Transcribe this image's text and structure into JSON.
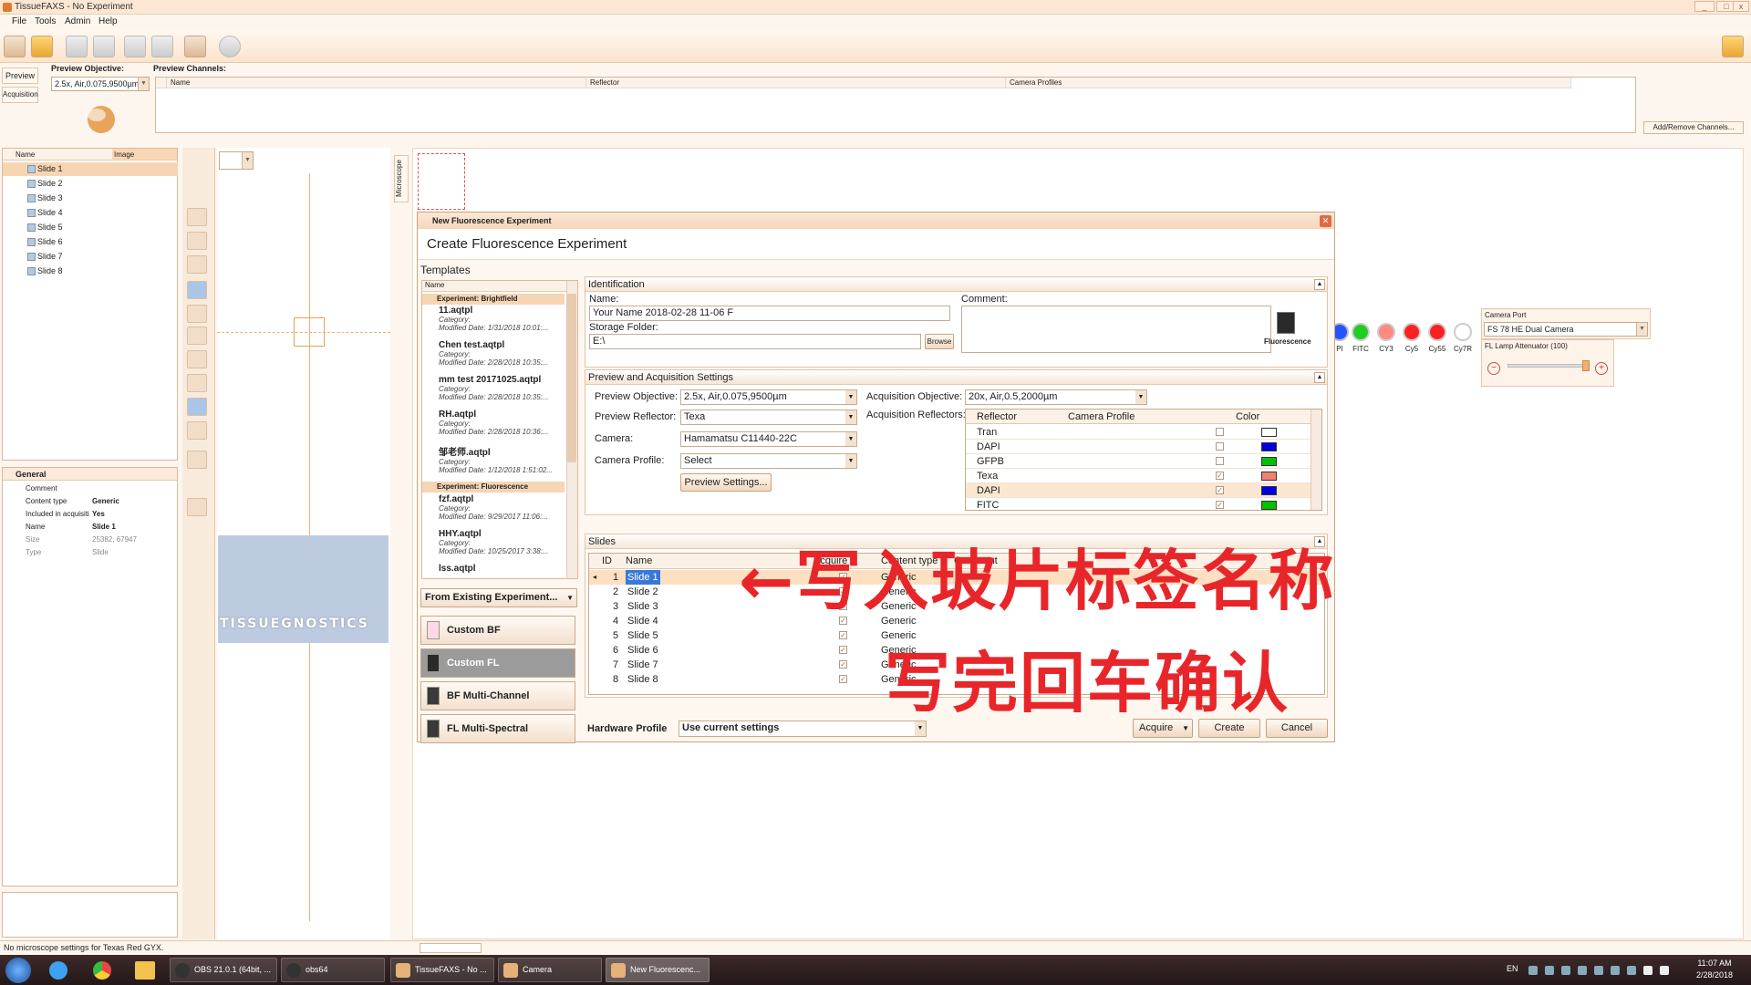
{
  "window": {
    "title": "TissueFAXS - No Experiment"
  },
  "menu": [
    "File",
    "Tools",
    "Admin",
    "Help"
  ],
  "left_tabs": [
    "Preview",
    "Acquisition"
  ],
  "preview_objective": {
    "label": "Preview Objective:",
    "value": "2.5x, Air,0.075,9500µm"
  },
  "preview_channels": {
    "label": "Preview Channels:",
    "columns": [
      "Name",
      "Reflector",
      "Camera Profiles"
    ],
    "add_remove": "Add/Remove Channels..."
  },
  "slide_tree": {
    "columns": [
      "Name",
      "Image"
    ],
    "items": [
      "Slide 1",
      "Slide 2",
      "Slide 3",
      "Slide 4",
      "Slide 5",
      "Slide 6",
      "Slide 7",
      "Slide 8"
    ]
  },
  "general": {
    "title": "General",
    "props": [
      {
        "k": "Comment",
        "v": ""
      },
      {
        "k": "Content type",
        "v": "Generic"
      },
      {
        "k": "Included in acquisiti",
        "v": "Yes"
      },
      {
        "k": "Name",
        "v": "Slide 1"
      },
      {
        "k": "Size",
        "v": "25382, 67947"
      },
      {
        "k": "Type",
        "v": "Slide"
      }
    ]
  },
  "logo": "TISSUEGNOSTICS",
  "microscope_tab": "Microscope",
  "dialog": {
    "title": "New Fluorescence Experiment",
    "subtitle": "Create Fluorescence Experiment",
    "templates": {
      "title": "Templates",
      "col": "Name",
      "groups": [
        {
          "name": "Experiment: Brightfield",
          "items": [
            {
              "n": "11.aqtpl",
              "c": "Category:",
              "d": "Modified Date: 1/31/2018 10:01:..."
            },
            {
              "n": "Chen test.aqtpl",
              "c": "Category:",
              "d": "Modified Date: 2/28/2018 10:35:..."
            },
            {
              "n": "mm test 20171025.aqtpl",
              "c": "Category:",
              "d": "Modified Date: 2/28/2018 10:35:..."
            },
            {
              "n": "RH.aqtpl",
              "c": "Category:",
              "d": "Modified Date: 2/28/2018 10:36:..."
            },
            {
              "n": "邹老师.aqtpl",
              "c": "Category:",
              "d": "Modified Date: 1/12/2018 1:51:02..."
            }
          ]
        },
        {
          "name": "Experiment: Fluorescence",
          "items": [
            {
              "n": "fzf.aqtpl",
              "c": "Category:",
              "d": "Modified Date: 9/29/2017 11:06:..."
            },
            {
              "n": "HHY.aqtpl",
              "c": "Category:",
              "d": "Modified Date: 10/25/2017 3:38:..."
            },
            {
              "n": "lss.aqtpl",
              "c": "",
              "d": ""
            }
          ]
        }
      ],
      "from_existing": "From Existing Experiment...",
      "buttons": [
        "Custom BF",
        "Custom FL",
        "BF Multi-Channel",
        "FL Multi-Spectral"
      ]
    },
    "identification": {
      "title": "Identification",
      "name_label": "Name:",
      "name_value": "Your Name 2018-02-28 11-06 F",
      "storage_label": "Storage Folder:",
      "storage_value": "E:\\",
      "browse": "Browse",
      "comment_label": "Comment:",
      "icon_label": "Fluorescence"
    },
    "settings": {
      "title": "Preview and Acquisition Settings",
      "preview_objective_label": "Preview Objective:",
      "preview_objective": "2.5x, Air,0.075,9500µm",
      "preview_reflector_label": "Preview Reflector:",
      "preview_reflector": "Texa",
      "camera_label": "Camera:",
      "camera": "Hamamatsu C11440-22C",
      "camera_profile_label": "Camera Profile:",
      "camera_profile": "Select",
      "preview_settings": "Preview Settings...",
      "acq_objective_label": "Acquisition Objective:",
      "acq_objective": "20x, Air,0.5,2000µm",
      "acq_reflectors_label": "Acquisition Reflectors:",
      "ref_columns": [
        "Reflector",
        "Camera Profile",
        "Color"
      ],
      "reflectors": [
        {
          "name": "Tran",
          "checked": false,
          "color": "#ffffff"
        },
        {
          "name": "DAPI",
          "checked": false,
          "color": "#0000e0"
        },
        {
          "name": "GFPB",
          "checked": false,
          "color": "#00c000"
        },
        {
          "name": "Texa",
          "checked": true,
          "color": "#f08070"
        },
        {
          "name": "DAPI",
          "checked": true,
          "color": "#0000e0"
        },
        {
          "name": "FITC",
          "checked": true,
          "color": "#00c000"
        }
      ]
    },
    "slides": {
      "title": "Slides",
      "columns": [
        "ID",
        "Name",
        "Acquire",
        "Content type",
        "Comment"
      ],
      "rows": [
        {
          "id": "1",
          "name": "Slide 1",
          "type": "Generic"
        },
        {
          "id": "2",
          "name": "Slide 2",
          "type": "Generic"
        },
        {
          "id": "3",
          "name": "Slide 3",
          "type": "Generic"
        },
        {
          "id": "4",
          "name": "Slide 4",
          "type": "Generic"
        },
        {
          "id": "5",
          "name": "Slide 5",
          "type": "Generic"
        },
        {
          "id": "6",
          "name": "Slide 6",
          "type": "Generic"
        },
        {
          "id": "7",
          "name": "Slide 7",
          "type": "Generic"
        },
        {
          "id": "8",
          "name": "Slide 8",
          "type": "Generic"
        }
      ]
    },
    "hardware_profile_label": "Hardware Profile",
    "hardware_profile": "Use current settings",
    "acquire": "Acquire",
    "create": "Create",
    "cancel": "Cancel"
  },
  "dyes": [
    "PI",
    "FITC",
    "CY3",
    "Cy5",
    "Cy55",
    "Cy7R"
  ],
  "dye_colors": [
    "#2255ff",
    "#22cc22",
    "#ff8a80",
    "#ff2020",
    "#ff2020",
    "#ffffff"
  ],
  "camera_port": {
    "label": "Camera Port",
    "value": "FS 78 HE Dual Camera"
  },
  "fl_lamp": {
    "label": "FL Lamp Attenuator (100)"
  },
  "annotation": {
    "line1": "←写入玻片标签名称",
    "line2": "写完回车确认"
  },
  "status": "No microscope settings for Texas Red GYX.",
  "taskbar": {
    "items": [
      "OBS 21.0.1 (64bit, ...",
      "obs64",
      "TissueFAXS - No ...",
      "Camera",
      "New Fluorescenc..."
    ],
    "lang": "EN",
    "time": "11:07 AM",
    "date": "2/28/2018"
  }
}
